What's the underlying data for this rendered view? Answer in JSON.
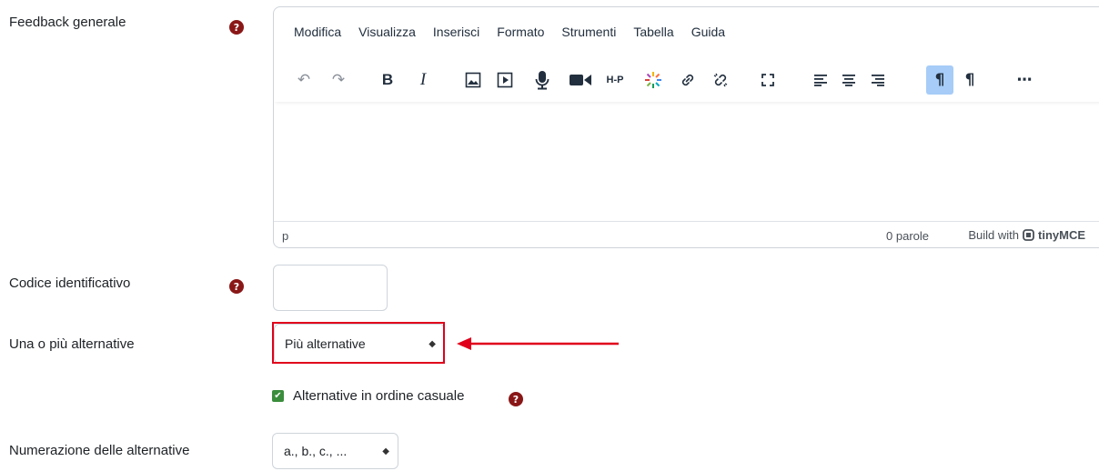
{
  "fields": {
    "feedback_label": "Feedback generale",
    "idnumber_label": "Codice identificativo",
    "single_label": "Una o più alternative",
    "numbering_label": "Numerazione delle alternative"
  },
  "help_glyph": "?",
  "editor": {
    "menu": [
      "Modifica",
      "Visualizza",
      "Inserisci",
      "Formato",
      "Strumenti",
      "Tabella",
      "Guida"
    ],
    "toolbar_icons": {
      "undo": "↶",
      "redo": "↷",
      "bold": "B",
      "italic": "I",
      "image": "🖼",
      "media": "▶",
      "record_audio": "🎙",
      "record_video": "■◀",
      "h5p": "H-P",
      "spark": "✳",
      "link": "🔗",
      "unlink": "⛓",
      "fullscreen": "⛶",
      "align_left": "≡",
      "align_center": "≡",
      "align_right": "≡",
      "ltr": "¶",
      "rtl": "¶",
      "more": "⋯"
    },
    "status_path": "p",
    "word_count": "0 parole",
    "build_with": "Build with",
    "brand_name": "tinyMCE"
  },
  "single_select": {
    "value": "Più alternative",
    "arrow": "◆"
  },
  "shuffle": {
    "label": "Alternative in ordine casuale",
    "checked": true,
    "check_glyph": "✔"
  },
  "numbering_select": {
    "value": "a., b., c., ...",
    "arrow": "◆"
  },
  "colors": {
    "help": "#8a1717",
    "highlight": "#e0001b",
    "checkbox": "#3a8d3c",
    "active_button": "#a6ccf7"
  }
}
